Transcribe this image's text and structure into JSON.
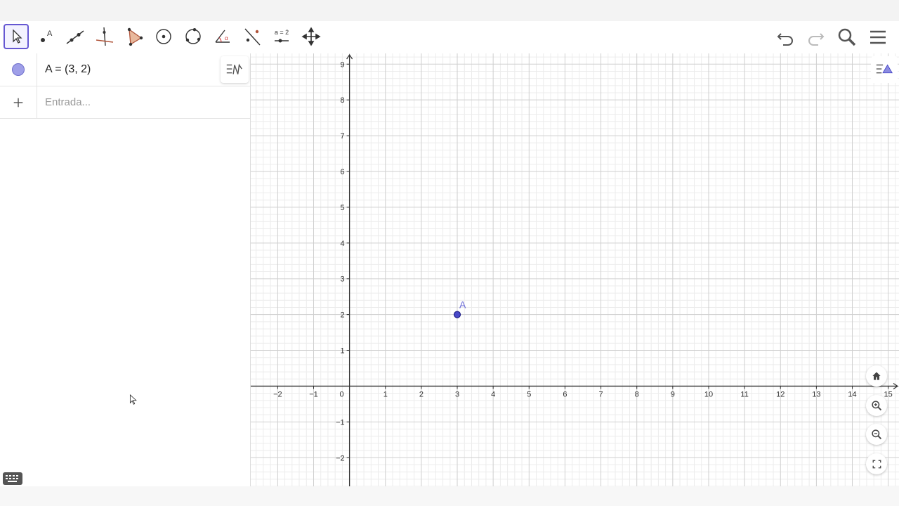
{
  "toolbar": {
    "tools": [
      {
        "name": "move-tool-icon",
        "active": true
      },
      {
        "name": "point-tool-icon",
        "label": "A"
      },
      {
        "name": "line-tool-icon"
      },
      {
        "name": "perpendicular-line-tool-icon"
      },
      {
        "name": "polygon-tool-icon"
      },
      {
        "name": "circle-center-point-tool-icon"
      },
      {
        "name": "circle-three-points-tool-icon"
      },
      {
        "name": "angle-tool-icon"
      },
      {
        "name": "reflect-tool-icon"
      },
      {
        "name": "slider-tool-icon",
        "label": "a = 2"
      },
      {
        "name": "move-graphics-view-tool-icon"
      }
    ],
    "right": [
      "undo-icon",
      "redo-icon",
      "search-icon",
      "menu-icon"
    ]
  },
  "algebra": {
    "rows": [
      {
        "marker": "visibility-toggle",
        "text": "A = (3, 2)"
      },
      {
        "marker": "plus-icon",
        "placeholder": "Entrada..."
      }
    ]
  },
  "graph": {
    "x_ticks": [
      "−2",
      "−1",
      "0",
      "1",
      "2",
      "3",
      "4",
      "5",
      "6",
      "7",
      "8",
      "9",
      "10",
      "11",
      "12",
      "13",
      "14",
      "15"
    ],
    "y_ticks": [
      "−2",
      "−1",
      "1",
      "2",
      "3",
      "4",
      "5",
      "6",
      "7",
      "8",
      "9"
    ],
    "x_range": [
      -2.75,
      15.3
    ],
    "y_range": [
      -2.8,
      9.3
    ],
    "points": [
      {
        "label": "A",
        "x": 3,
        "y": 2,
        "color": "#4848c8"
      }
    ]
  },
  "colors": {
    "accent": "#6557d2",
    "point": "#4848c8",
    "grid_major": "#cfcfcf",
    "grid_minor": "#ececec"
  }
}
